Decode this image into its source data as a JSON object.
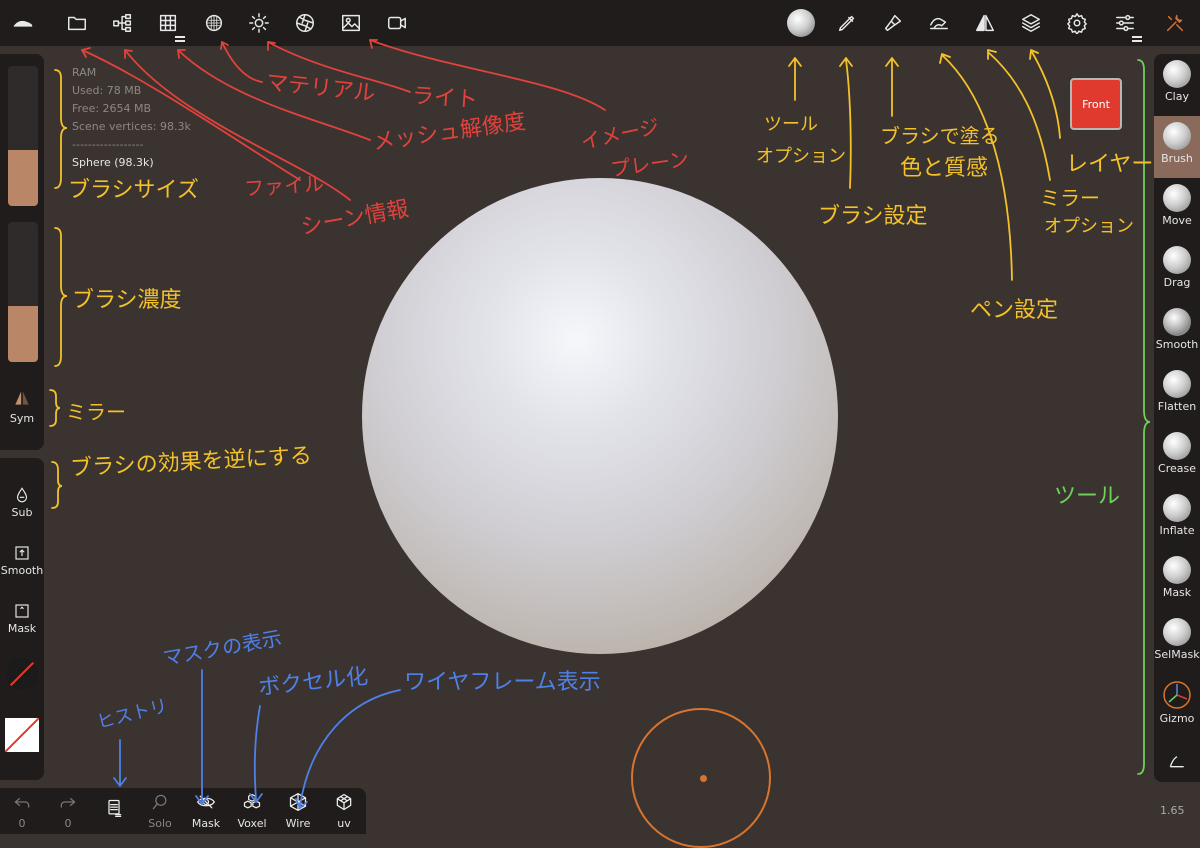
{
  "topbar": {
    "left_icons": [
      "logo-icon",
      "folder-icon",
      "scene-tree-icon",
      "grid-icon",
      "material-icon",
      "sun-icon",
      "aperture-icon",
      "image-icon",
      "video-icon"
    ],
    "right_icons": [
      "brush-preview-icon",
      "pen-icon",
      "paint-brush-icon",
      "stylus-icon",
      "mirror-icon",
      "layers-icon",
      "gear-icon",
      "sliders-icon",
      "tools-icon"
    ],
    "accent": "#d8742e"
  },
  "scene_info": {
    "ram": "RAM",
    "used": "Used: 78 MB",
    "free": "Free: 2654 MB",
    "vertices": "Scene vertices: 98.3k",
    "divider": "------------------",
    "object": "Sphere (98.3k)"
  },
  "left_panel": {
    "sym_label": "Sym",
    "radius_fill": 0.4,
    "intensity_fill": 0.4,
    "buttons": [
      {
        "icon": "drop-icon",
        "label": "Sub"
      },
      {
        "icon": "smooth-square-icon",
        "label": "Smooth"
      },
      {
        "icon": "mask-square-icon",
        "label": "Mask"
      }
    ]
  },
  "right_panel": {
    "front_label": "Front",
    "tools": [
      {
        "label": "Clay",
        "active": false
      },
      {
        "label": "Brush",
        "active": true
      },
      {
        "label": "Move",
        "active": false
      },
      {
        "label": "Drag",
        "active": false
      },
      {
        "label": "Smooth",
        "active": false
      },
      {
        "label": "Flatten",
        "active": false
      },
      {
        "label": "Crease",
        "active": false
      },
      {
        "label": "Inflate",
        "active": false
      },
      {
        "label": "Mask",
        "active": false
      },
      {
        "label": "SelMask",
        "active": false
      },
      {
        "label": "Gizmo",
        "active": false
      }
    ],
    "version": "1.65"
  },
  "bottombar": {
    "undo_count": "0",
    "redo_count": "0",
    "buttons": [
      {
        "icon": "history-icon",
        "label": ""
      },
      {
        "icon": "search-icon",
        "label": "Solo"
      },
      {
        "icon": "eye-slash-icon",
        "label": "Mask"
      },
      {
        "icon": "voxel-icon",
        "label": "Voxel"
      },
      {
        "icon": "wireframe-icon",
        "label": "Wire"
      },
      {
        "icon": "uv-icon",
        "label": "uv"
      }
    ]
  },
  "annotations": {
    "material": "マテリアル",
    "light": "ライト",
    "mesh_resolution": "メッシュ解像度",
    "image_plane_1": "イメージ",
    "image_plane_2": "プレーン",
    "file": "ファイル",
    "scene_info": "シーン情報",
    "brush_size": "ブラシサイズ",
    "brush_intensity": "ブラシ濃度",
    "mirror": "ミラー",
    "invert": "ブラシの効果を逆にする",
    "tool_options_1": "ツール",
    "tool_options_2": "オプション",
    "brush_settings": "ブラシ設定",
    "paint_1": "ブラシで塗る",
    "paint_2": "色と質感",
    "pen_settings": "ペン設定",
    "mirror_options_1": "ミラー",
    "mirror_options_2": "オプション",
    "layer": "レイヤー",
    "tools": "ツール",
    "history": "ヒストリ",
    "mask_display": "マスクの表示",
    "voxel": "ボクセル化",
    "wireframe": "ワイヤフレーム表示"
  }
}
